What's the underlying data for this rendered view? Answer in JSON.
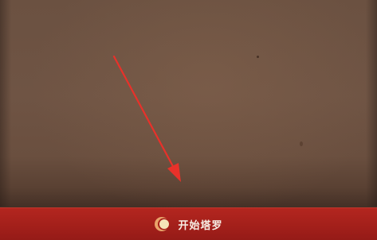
{
  "start_bar": {
    "label": "开始塔罗",
    "icon": "moon-phase-icon",
    "background_color": "#a82019",
    "text_color": "#f7ede4"
  },
  "annotation": {
    "arrow_color": "#e8312a"
  },
  "board": {
    "color": "#6a5040"
  }
}
